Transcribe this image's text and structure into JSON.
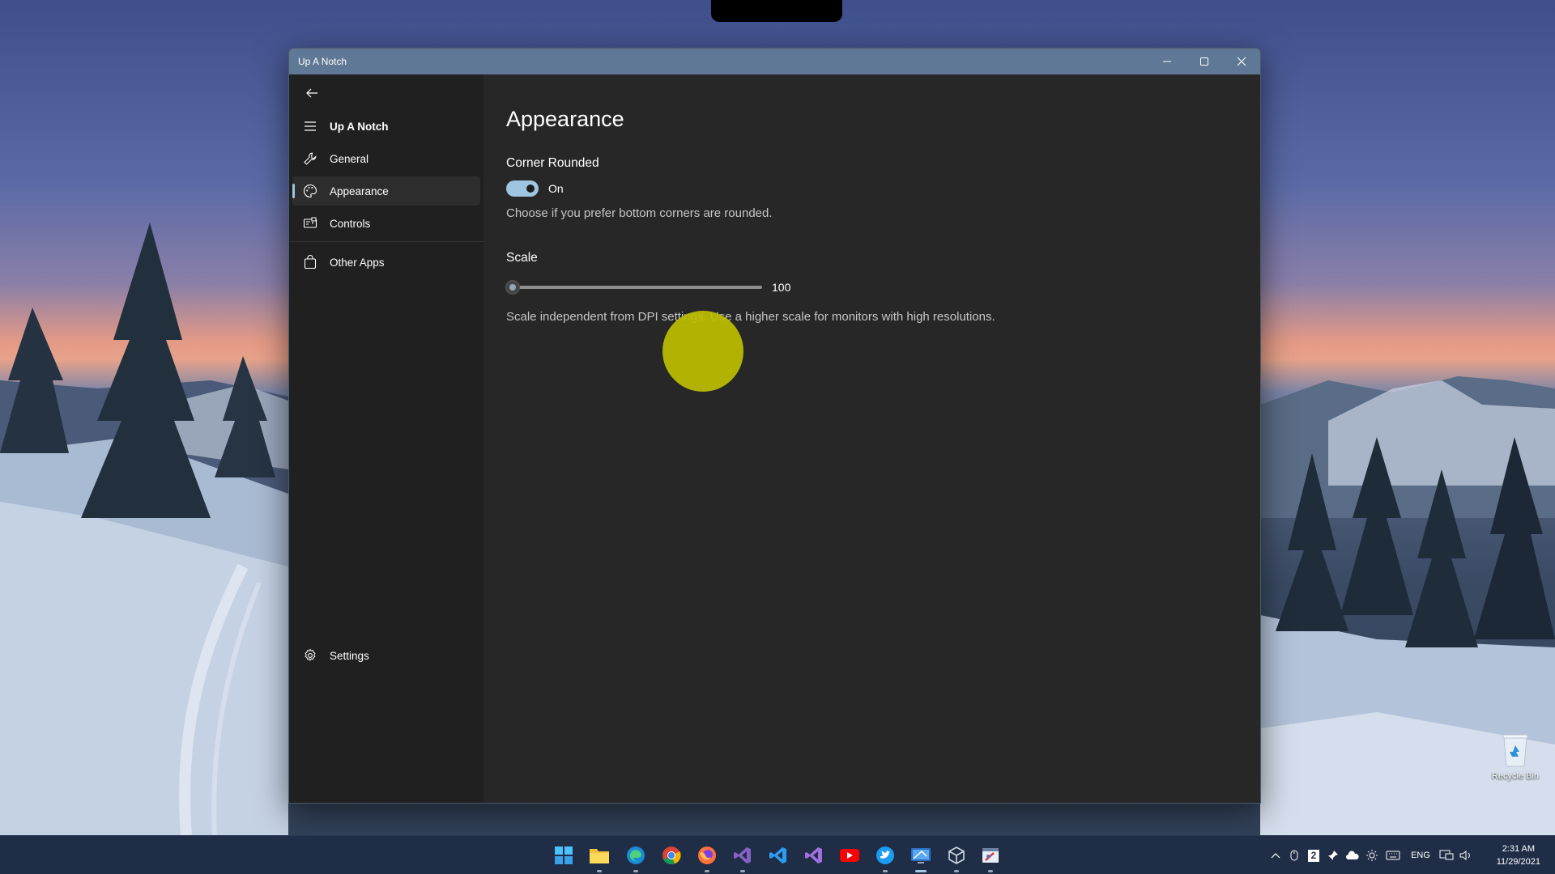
{
  "window": {
    "title": "Up A Notch"
  },
  "sidebar": {
    "header": "Up A Notch",
    "items": [
      {
        "label": "General"
      },
      {
        "label": "Appearance"
      },
      {
        "label": "Controls"
      },
      {
        "label": "Other Apps"
      }
    ],
    "footer": "Settings",
    "selected": "Appearance"
  },
  "main": {
    "title": "Appearance",
    "corner": {
      "label": "Corner Rounded",
      "state": "On",
      "description": "Choose if you prefer bottom corners are rounded."
    },
    "scale": {
      "label": "Scale",
      "value": "100",
      "position_fraction": 0.0,
      "description": "Scale independent from DPI settings. Use a higher scale for monitors with high resolutions."
    }
  },
  "desktop": {
    "recycle_bin": "Recycle Bin"
  },
  "taskbar": {
    "apps": [
      "start-icon",
      "file-explorer-icon",
      "edge-icon",
      "chrome-icon",
      "firefox-icon",
      "visual-studio-icon",
      "vscode-icon",
      "visual-studio-preview-icon",
      "youtube-icon",
      "twitter-icon",
      "remote-desktop-icon",
      "virtualbox-icon",
      "paint-icon"
    ],
    "tray_badge": "2",
    "language": "ENG",
    "time": "2:31 AM",
    "date": "11/29/2021"
  },
  "colors": {
    "accent": "#9fc6e0",
    "titlebar": "#5e7895",
    "window_bg": "#272727",
    "sidebar_bg": "#202020",
    "cursor_highlight": "#bebe00"
  }
}
